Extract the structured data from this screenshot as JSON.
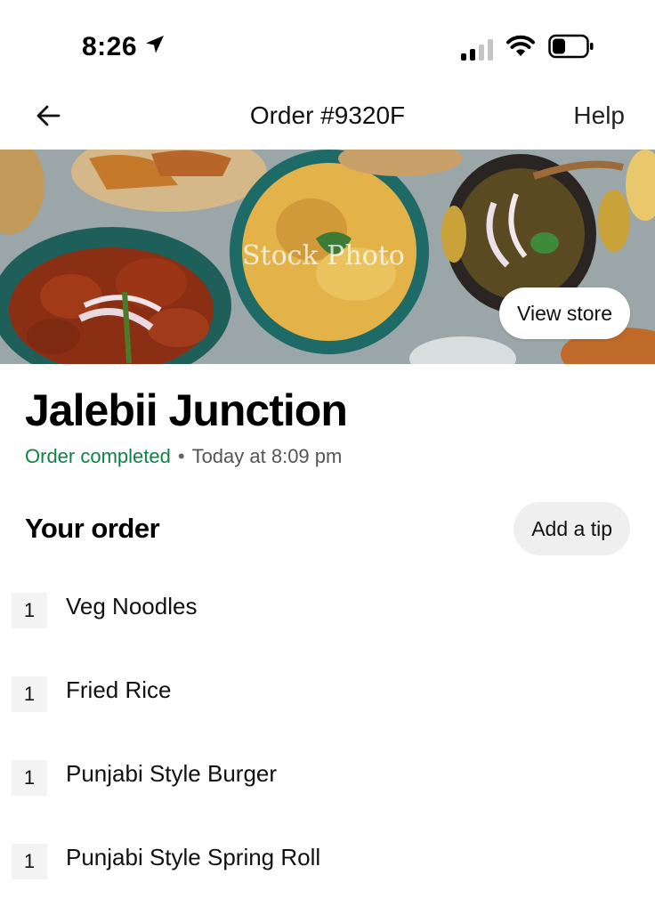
{
  "status_bar": {
    "time": "8:26",
    "icons": [
      "location-arrow-icon",
      "cellular-signal-icon",
      "wifi-icon",
      "battery-icon"
    ]
  },
  "header": {
    "back_icon": "arrow-left-icon",
    "title": "Order #9320F",
    "help_label": "Help"
  },
  "banner": {
    "watermark": "Stock Photo",
    "view_store_label": "View store"
  },
  "store": {
    "name": "Jalebii Junction",
    "status": "Order completed",
    "separator": "•",
    "time": "Today at 8:09 pm"
  },
  "order": {
    "heading": "Your order",
    "tip_label": "Add a tip",
    "items": [
      {
        "qty": "1",
        "name": "Veg Noodles"
      },
      {
        "qty": "1",
        "name": "Fried Rice"
      },
      {
        "qty": "1",
        "name": "Punjabi Style Burger"
      },
      {
        "qty": "1",
        "name": "Punjabi Style Spring Roll"
      }
    ]
  },
  "colors": {
    "status_green": "#0e8345",
    "pill_gray": "#efefef",
    "qty_bg": "#f3f3f3"
  }
}
